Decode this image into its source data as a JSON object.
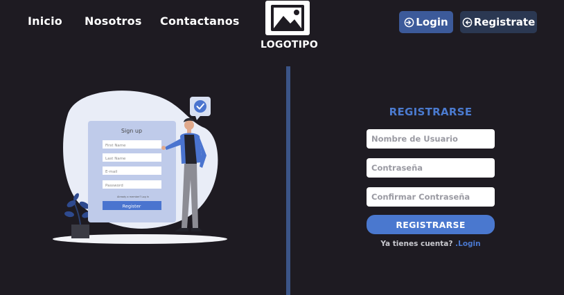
{
  "nav": {
    "items": [
      {
        "label": "Inicio"
      },
      {
        "label": "Nosotros"
      },
      {
        "label": "Contactanos"
      }
    ]
  },
  "logo": {
    "text": "LOGOTIPO",
    "icon": "image-icon"
  },
  "header_buttons": {
    "login_label": "Login",
    "login_icon": "sign-in-icon",
    "register_label": "Registrate",
    "register_icon": "sign-out-icon"
  },
  "illustration": {
    "card_title": "Sign up",
    "fields": [
      "First Name",
      "Last Name",
      "E-mail",
      "Password"
    ],
    "small_text": "Already a member? Log In",
    "button_label": "Register"
  },
  "form": {
    "title": "REGISTRARSE",
    "username_placeholder": "Nombre de Usuario",
    "password_placeholder": "Contraseña",
    "confirm_placeholder": "Confirmar Contraseña",
    "submit_label": "REGISTRARSE",
    "have_account_text": "Ya tienes cuenta? ",
    "login_link": ".Login"
  },
  "colors": {
    "background": "#1e1b22",
    "accent": "#4a78cf",
    "divider": "#3b5487"
  }
}
